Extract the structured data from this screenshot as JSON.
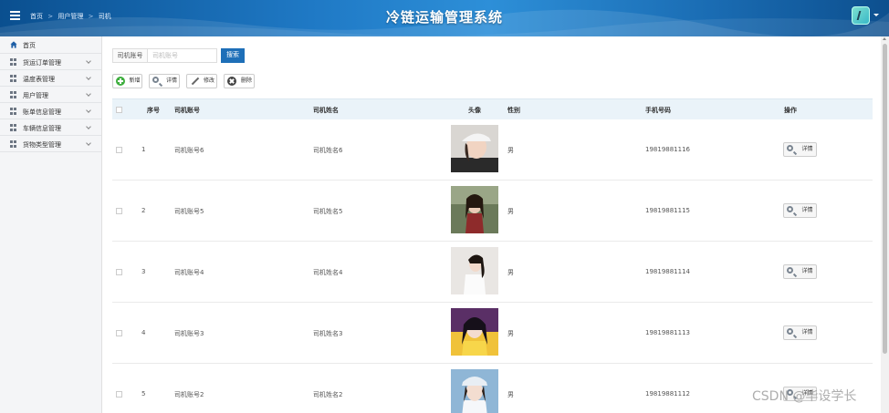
{
  "header": {
    "breadcrumbs": [
      "首页",
      "用户管理",
      "司机"
    ],
    "breadcrumb_separator": ">",
    "title": "冷链运输管理系统",
    "color": "#1a6cb3"
  },
  "sidebar": {
    "items": [
      {
        "label": "首页",
        "icon": "home-icon"
      },
      {
        "label": "货运订单管理",
        "icon": "grid-icon"
      },
      {
        "label": "温度表管理",
        "icon": "grid-icon"
      },
      {
        "label": "用户管理",
        "icon": "grid-icon"
      },
      {
        "label": "账单信息管理",
        "icon": "grid-icon"
      },
      {
        "label": "车辆信息管理",
        "icon": "grid-icon"
      },
      {
        "label": "货物类型管理",
        "icon": "grid-icon"
      }
    ]
  },
  "search": {
    "label": "司机账号",
    "placeholder": "司机账号",
    "value": "",
    "button": "搜索"
  },
  "toolbar": {
    "add": "新增",
    "detail": "详情",
    "edit": "修改",
    "delete": "删除"
  },
  "table": {
    "columns": [
      "序号",
      "司机账号",
      "司机姓名",
      "头像",
      "性别",
      "手机号码",
      "操作"
    ],
    "action_label": "详情",
    "rows": [
      {
        "index": "1",
        "account": "司机账号6",
        "name": "司机姓名6",
        "gender": "男",
        "phone": "19819881116"
      },
      {
        "index": "2",
        "account": "司机账号5",
        "name": "司机姓名5",
        "gender": "男",
        "phone": "19819881115"
      },
      {
        "index": "3",
        "account": "司机账号4",
        "name": "司机姓名4",
        "gender": "男",
        "phone": "19819881114"
      },
      {
        "index": "4",
        "account": "司机账号3",
        "name": "司机姓名3",
        "gender": "男",
        "phone": "19819881113"
      },
      {
        "index": "5",
        "account": "司机账号2",
        "name": "司机姓名2",
        "gender": "男",
        "phone": "19819881112"
      }
    ]
  },
  "watermark": "CSDN @毕设学长"
}
